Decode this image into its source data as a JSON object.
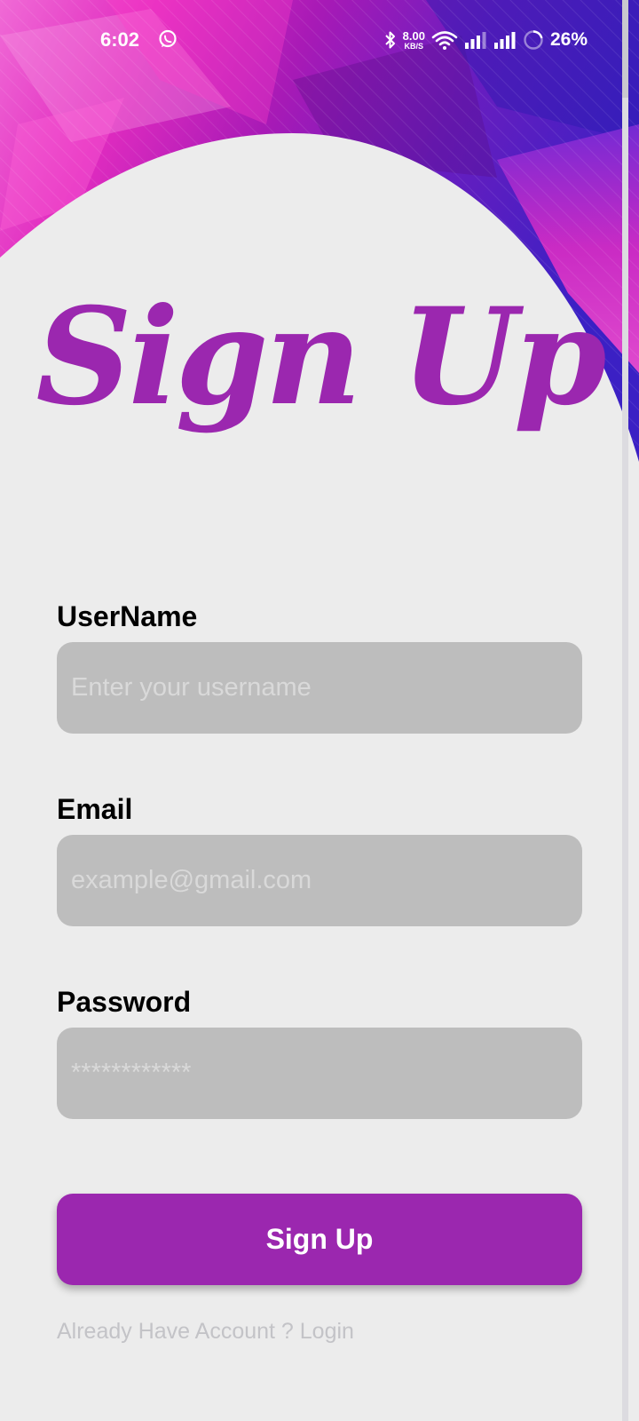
{
  "status_bar": {
    "time": "6:02",
    "network_speed_value": "8.00",
    "network_speed_unit": "KB/S",
    "battery_percent": "26%",
    "icons": [
      "whatsapp-icon",
      "bluetooth-icon",
      "wifi-icon",
      "signal-icon",
      "signal-icon",
      "battery-icon"
    ]
  },
  "screen": {
    "title": "Sign Up"
  },
  "form": {
    "username": {
      "label": "UserName",
      "value": "",
      "placeholder": "Enter your username"
    },
    "email": {
      "label": "Email",
      "value": "",
      "placeholder": "example@gmail.com"
    },
    "password": {
      "label": "Password",
      "value": "",
      "placeholder": "************"
    },
    "submit_label": "Sign Up",
    "login_link": "Already Have Account ? Login"
  },
  "colors": {
    "accent": "#9b27af",
    "background": "#ececec",
    "input_fill": "#bdbdbd",
    "placeholder": "#d9d9d9",
    "link": "#c3c3c7"
  }
}
